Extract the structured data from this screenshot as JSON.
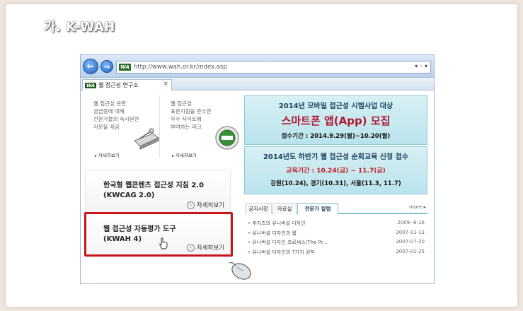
{
  "slide": {
    "title": "가. K-WAH"
  },
  "browser": {
    "address": "http://www.wah.or.kr/index.asp",
    "address_badge": "WA",
    "tab_badge": "WA",
    "tab_label": "웹 접근성 연구소",
    "tab_close": "×",
    "address_tools": "▾ ◦ ▾",
    "back_glyph": "←",
    "forward_glyph": "→"
  },
  "cards": [
    {
      "text": "웹 접근성 관련\n궁금증에 대해\n전문가들의 속시원한\n자문을 제공",
      "more": "자세히보기"
    },
    {
      "text": "웹 접근성\n표준지침을 준수한\n우수 사이트에\n부여하는 마크",
      "more": "자세히보기"
    }
  ],
  "guide": {
    "title": "한국형 웹콘텐츠 접근성 지침 2.0\n(KWCAG 2.0)",
    "more": "자세히보기"
  },
  "kwah": {
    "title": "웹 접근성 자동평가 도구\n(KWAH 4)",
    "more": "자세히보기"
  },
  "banner_mobile": {
    "head": "2014년 모바일 접근성 시범사업 대상",
    "main": "스마트폰 앱(App) 모집",
    "sub": "접수기간 : 2014.9.29(월)~10.20(월)"
  },
  "banner_edu": {
    "head": "2014년도 하반기 웹 접근성 순회교육 신청 접수",
    "period": "교육기간 : 10.24(금) ~ 11.7(금)",
    "cities": "강원(10.24), 경기(10.31), 서울(11.3, 11.7)"
  },
  "news": {
    "tabs": [
      "공지사항",
      "자료실",
      "전문가 칼럼"
    ],
    "more": "more ▸",
    "items": [
      {
        "title": "후지츠의 유니버설 디자인",
        "date": "2009--6-16"
      },
      {
        "title": "유니버설 디자인과 웹",
        "date": "2007-11-13"
      },
      {
        "title": "유니버설 디자인 프로세스(The Pr...",
        "date": "2007-07-20"
      },
      {
        "title": "유니버설 디자인의 7가지 원칙",
        "date": "2007-01-25"
      }
    ]
  },
  "icons": {
    "detail": "arrow-right-circle-icon",
    "scanner": "scanner-icon",
    "cert": "certification-mark-icon",
    "mouse": "mouse-icon",
    "cursor": "hand-cursor-icon"
  },
  "colors": {
    "highlight": "#c8141b",
    "banner": "#c8e9f0",
    "accent": "#b01830"
  }
}
